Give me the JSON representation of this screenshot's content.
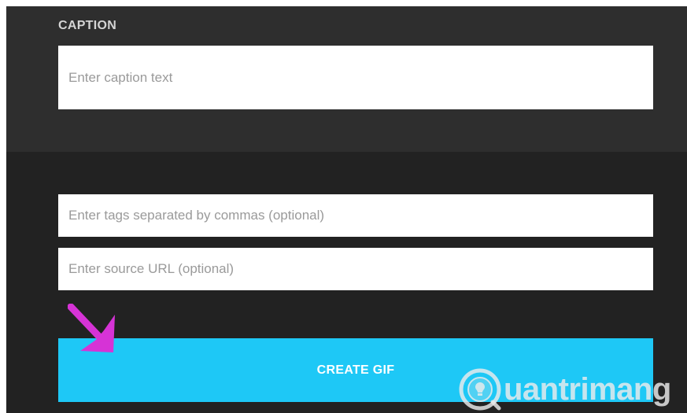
{
  "caption": {
    "label": "CAPTION",
    "placeholder": "Enter caption text"
  },
  "tags": {
    "placeholder": "Enter tags separated by commas (optional)"
  },
  "source": {
    "placeholder": "Enter source URL (optional)"
  },
  "create_button": {
    "label": "CREATE GIF"
  },
  "watermark": {
    "text": "uantrimang",
    "icon": "lightbulb-icon"
  },
  "annotation": {
    "icon": "arrow-pointer-icon",
    "color": "#d633d6"
  },
  "colors": {
    "button": "#1ec8f6",
    "panel": "#2e2e2e",
    "background": "#222222"
  }
}
